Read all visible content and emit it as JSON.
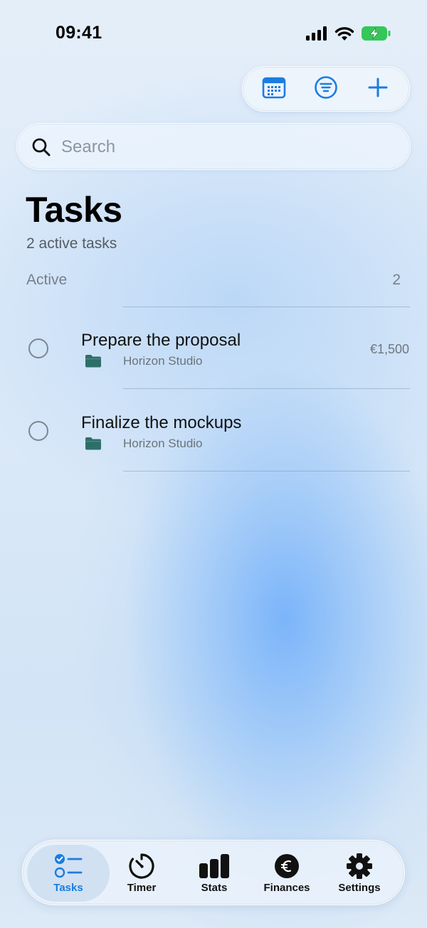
{
  "status_bar": {
    "time": "09:41"
  },
  "toolbar": {
    "calendar_icon": "calendar-icon",
    "filter_icon": "filter-icon",
    "add_icon": "plus-icon",
    "accent": "#1a7de0"
  },
  "search": {
    "placeholder": "Search"
  },
  "header": {
    "title": "Tasks",
    "subtitle": "2 active tasks"
  },
  "section": {
    "label": "Active",
    "count": "2"
  },
  "tasks": [
    {
      "title": "Prepare the proposal",
      "project": "Horizon Studio",
      "amount": "€1,500"
    },
    {
      "title": "Finalize the mockups",
      "project": "Horizon Studio",
      "amount": ""
    }
  ],
  "tabs": [
    {
      "label": "Tasks",
      "icon": "checklist-icon",
      "active": true
    },
    {
      "label": "Timer",
      "icon": "timer-icon",
      "active": false
    },
    {
      "label": "Stats",
      "icon": "bar-chart-icon",
      "active": false
    },
    {
      "label": "Finances",
      "icon": "euro-icon",
      "active": false
    },
    {
      "label": "Settings",
      "icon": "gear-icon",
      "active": false
    }
  ],
  "colors": {
    "accent": "#1a7de0",
    "folder": "#2e6e6a",
    "battery": "#34c759"
  }
}
